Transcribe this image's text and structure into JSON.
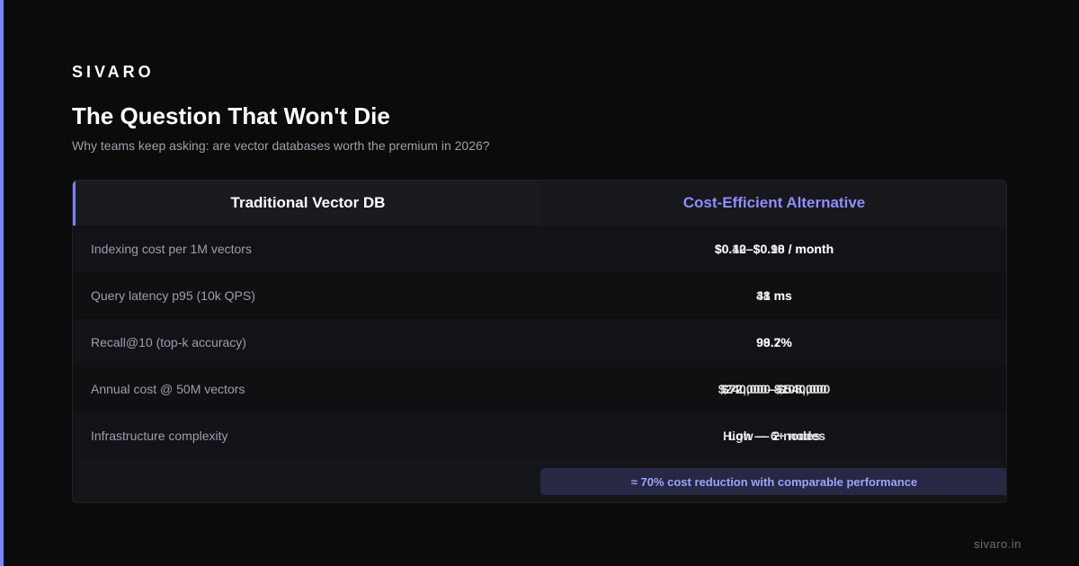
{
  "brand": "SIVARO",
  "title": "The Question That Won't Die",
  "subtitle": "Why teams keep asking: are vector databases worth the premium in 2026?",
  "table": {
    "headers": {
      "left": "Traditional Vector DB",
      "right": "Cost-Efficient Alternative"
    },
    "rows": [
      {
        "label": "Indexing cost per 1M vectors",
        "value_a": "$0.12–$0.18 / month",
        "value_b": "$0.40–$0.90 / month"
      },
      {
        "label": "Query latency p95 (10k QPS)",
        "value_a": "31 ms",
        "value_b": "48 ms"
      },
      {
        "label": "Recall@10 (top-k accuracy)",
        "value_a": "99.2%",
        "value_b": "98.7%"
      },
      {
        "label": "Annual cost @ 50M vectors",
        "value_a": "$72,000–$108,000",
        "value_b": "$240,000–$540,000"
      },
      {
        "label": "Infrastructure complexity",
        "value_a": "High — 6+ nodes",
        "value_b": "Low — 2 nodes"
      }
    ],
    "footer_note": "≈ 70% cost reduction with comparable performance"
  },
  "site": "sivaro.in",
  "colors": {
    "accent": "#7f83ff",
    "background": "#0b0b0c"
  }
}
